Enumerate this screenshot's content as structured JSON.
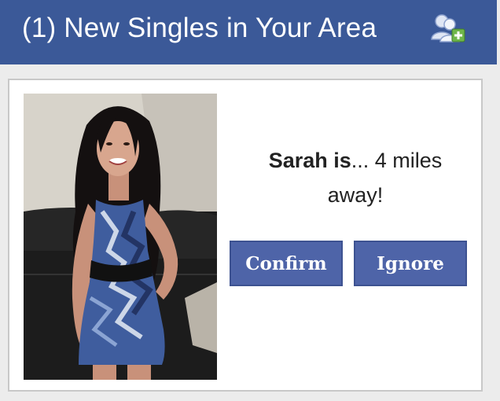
{
  "header": {
    "title": "(1) New Singles in Your Area",
    "icon": "add-friend-icon"
  },
  "card": {
    "name": "Sarah is",
    "detail": "... 4 miles away!",
    "confirm_label": "Confirm",
    "ignore_label": "Ignore"
  },
  "colors": {
    "header_bg": "#3b5998",
    "button_bg": "#4e64a8"
  }
}
